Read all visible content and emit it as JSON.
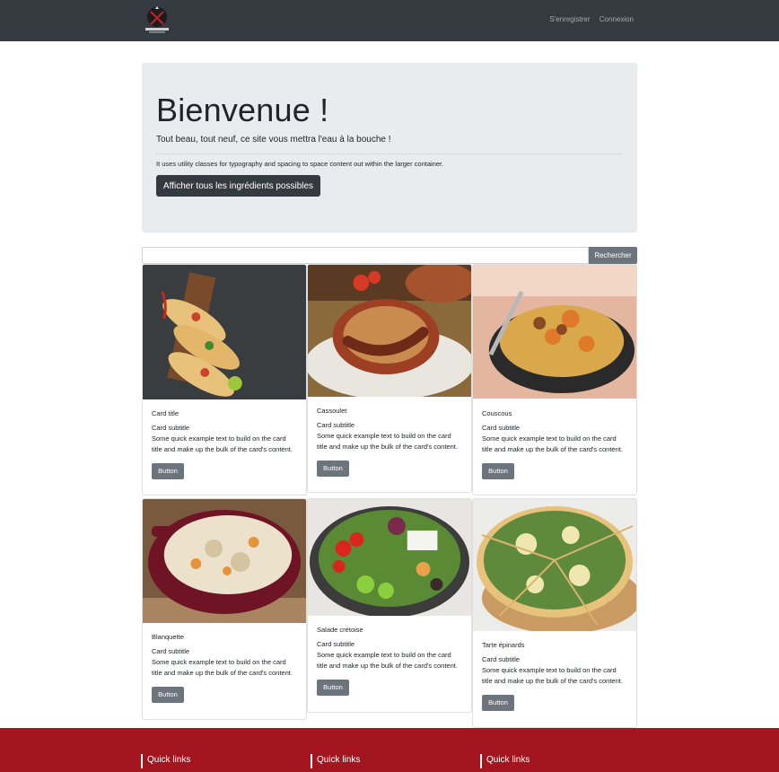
{
  "navbar": {
    "logo_text": "Cook Gourmet",
    "register_label": "S'enregistrer",
    "login_label": "Connexion"
  },
  "jumbotron": {
    "title": "Bienvenue !",
    "lead": "Tout beau, tout neuf, ce site vous mettra l'eau à la bouche !",
    "text": "It uses utility classes for typography and spacing to space content out within the larger container.",
    "button_label": "Afficher tous les ingrédients possibles"
  },
  "search": {
    "placeholder": "",
    "button_label": "Rechercher"
  },
  "cards": [
    {
      "title": "Card title",
      "subtitle": "Card subtitle",
      "text": "Some quick example text to build on the card title and make up the bulk of the card's content.",
      "button": "Button",
      "image": "tacos-image"
    },
    {
      "title": "Cassoulet",
      "subtitle": "Card subtitle",
      "text": "Some quick example text to build on the card title and make up the bulk of the card's content.",
      "button": "Button",
      "image": "cassoulet-image"
    },
    {
      "title": "Couscous",
      "subtitle": "Card subtitle",
      "text": "Some quick example text to build on the card title and make up the bulk of the card's content.",
      "button": "Button",
      "image": "couscous-image"
    },
    {
      "title": "Blanquette",
      "subtitle": "Card subtitle",
      "text": "Some quick example text to build on the card title and make up the bulk of the card's content.",
      "button": "Button",
      "image": "blanquette-image"
    },
    {
      "title": "Salade crétoise",
      "subtitle": "Card subtitle",
      "text": "Some quick example text to build on the card title and make up the bulk of the card's content.",
      "button": "Button",
      "image": "salad-image"
    },
    {
      "title": "Tarte épinards",
      "subtitle": "Card subtitle",
      "text": "Some quick example text to build on the card title and make up the bulk of the card's content.",
      "button": "Button",
      "image": "spinach-tart-image"
    }
  ],
  "footer": {
    "columns": [
      "Quick links",
      "Quick links",
      "Quick links"
    ]
  },
  "colors": {
    "navbar": "#343a40",
    "jumbotron": "#e9ecef",
    "button_secondary": "#6c757d",
    "footer": "#a3161f"
  }
}
